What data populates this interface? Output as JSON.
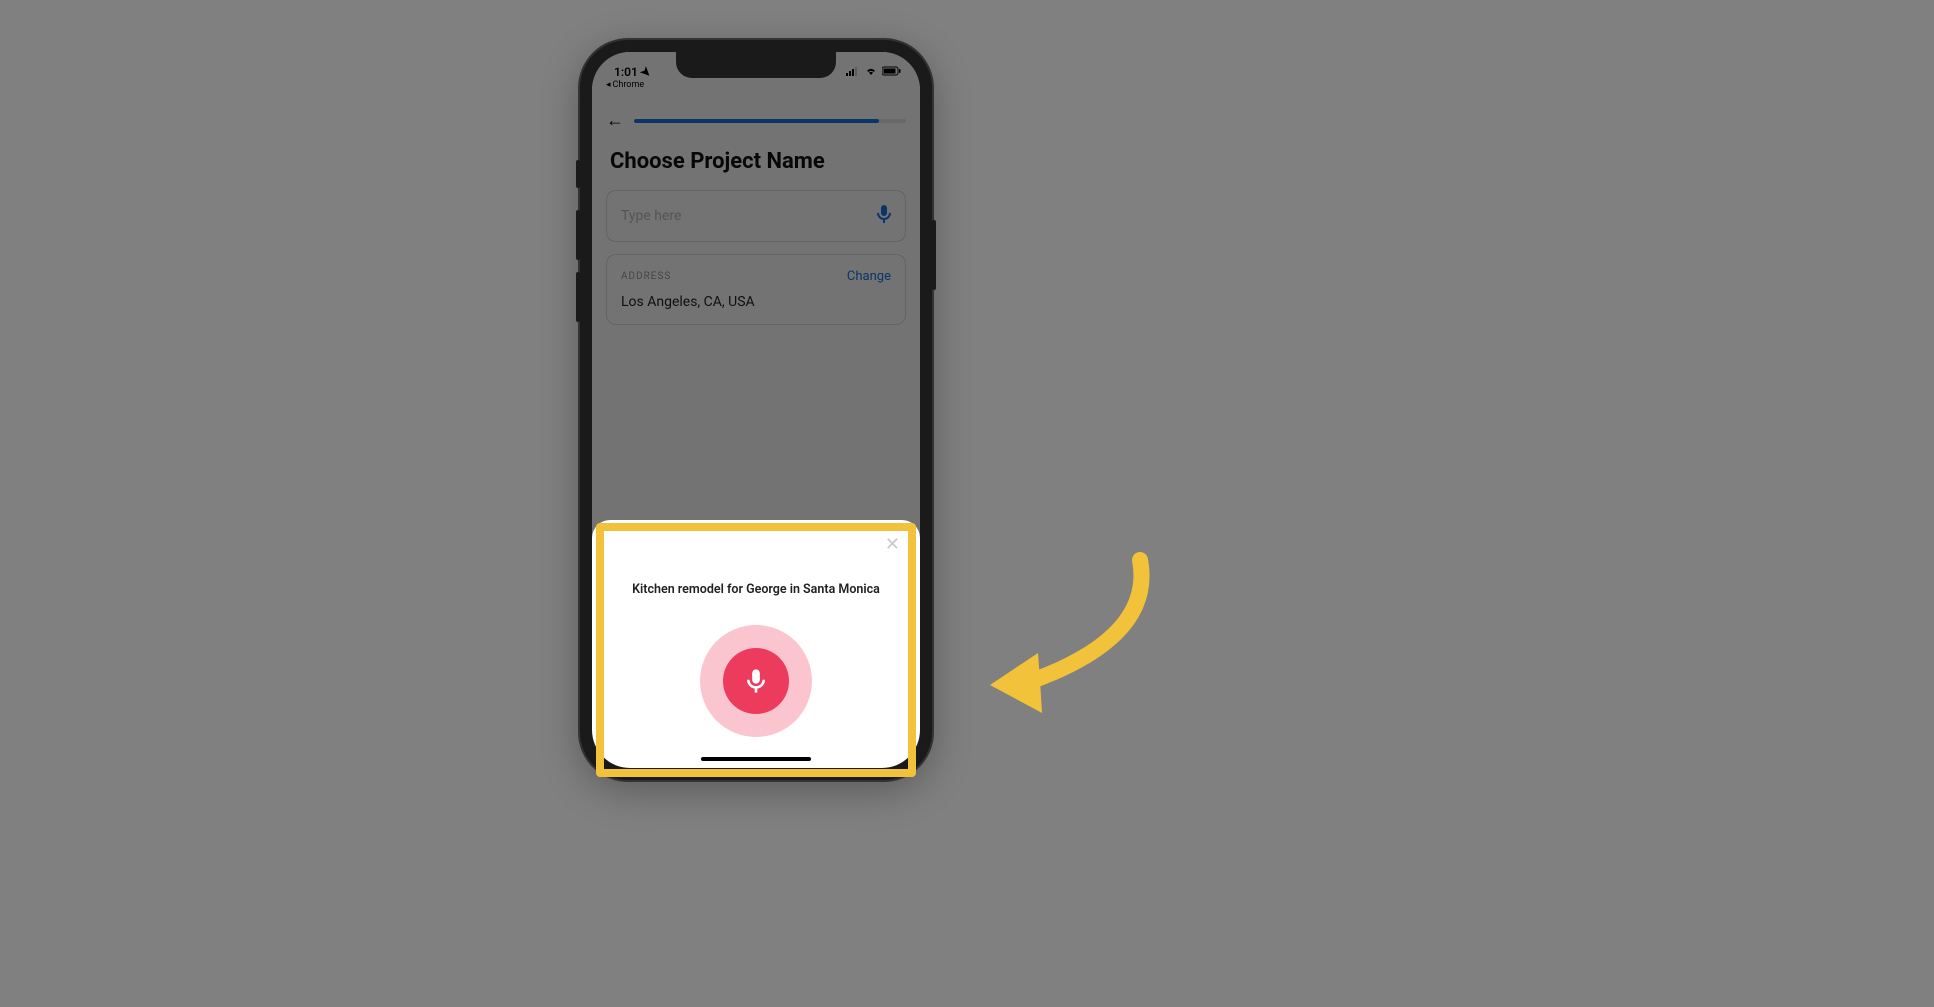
{
  "status_bar": {
    "time": "1:01",
    "back_app_label": "Chrome"
  },
  "page": {
    "title": "Choose Project Name"
  },
  "input_field": {
    "placeholder": "Type here"
  },
  "address_card": {
    "label": "ADDRESS",
    "change_label": "Change",
    "value": "Los Angeles, CA, USA"
  },
  "voice_sheet": {
    "transcript": "Kitchen remodel for George in Santa Monica"
  },
  "colors": {
    "accent": "#1a73e8",
    "highlight": "#f2c23a",
    "mic_primary": "#ec3b5d",
    "mic_halo": "#fbc5cf"
  }
}
